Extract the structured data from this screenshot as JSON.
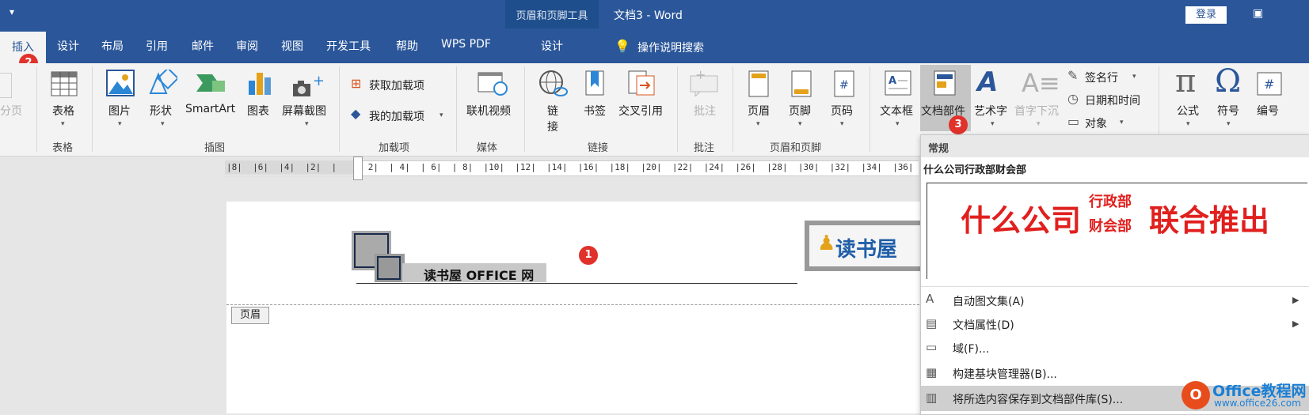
{
  "window": {
    "quick_access": "▾",
    "context_tab_group": "页眉和页脚工具",
    "doc_title": "文档3  -  Word",
    "login": "登录",
    "restore_icon": "▣"
  },
  "tabs": {
    "insert": "插入",
    "design": "设计",
    "layout": "布局",
    "references": "引用",
    "mailings": "邮件",
    "review": "审阅",
    "view": "视图",
    "developer": "开发工具",
    "help": "帮助",
    "wps_pdf": "WPS PDF",
    "context_design": "设计",
    "search_hint": "操作说明搜索"
  },
  "badges": {
    "one": "1",
    "two": "2",
    "three": "3"
  },
  "ribbon": {
    "page_break": "分页",
    "table": "表格",
    "picture": "图片",
    "shapes": "形状",
    "smartart": "SmartArt",
    "chart": "图表",
    "screenshot": "屏幕截图",
    "get_addins": "获取加载项",
    "my_addins": "我的加载项",
    "online_video": "联机视频",
    "link_line1": "链",
    "link_line2": "接",
    "bookmark": "书签",
    "cross_ref": "交叉引用",
    "comment": "批注",
    "header": "页眉",
    "footer": "页脚",
    "page_number": "页码",
    "text_box": "文本框",
    "quick_parts": "文档部件",
    "wordart": "艺术字",
    "drop_cap": "首字下沉",
    "signature_line": "签名行",
    "date_time": "日期和时间",
    "object": "对象",
    "equation": "公式",
    "symbol": "符号",
    "number": "编号",
    "groups": {
      "tables": "表格",
      "illustrations": "插图",
      "addins": "加载项",
      "media": "媒体",
      "links": "链接",
      "comments": "批注",
      "header_footer": "页眉和页脚"
    }
  },
  "ruler": "|8|  |6|  |4|  |2|  |    | 2|  | 4|  | 6|  | 8|  |10|  |12|  |14|  |16|  |18|  |20|  |22|  |24|  |26|  |28|  |30|  |32|  |34|  |36|",
  "document": {
    "header_text": "读书屋 OFFICE 网",
    "header_tag": "页眉",
    "logo_text": "读书屋"
  },
  "quick_parts_menu": {
    "section": "常规",
    "item_name": "什么公司行政部财会部",
    "preview": {
      "main_left": "什么公司",
      "small_top": "行政部",
      "small_bottom": "财会部",
      "main_right": "联合推出"
    },
    "items": [
      {
        "label": "自动图文集(A)",
        "icon": "A"
      },
      {
        "label": "文档属性(D)",
        "icon": "▤"
      },
      {
        "label": "域(F)...",
        "icon": "▭"
      },
      {
        "label": "构建基块管理器(B)...",
        "icon": "▦"
      },
      {
        "label": "将所选内容保存到文档部件库(S)...",
        "icon": "▥"
      }
    ]
  },
  "watermark": {
    "title": "Office教程网",
    "url": "www.office26.com"
  },
  "colors": {
    "brand": "#2b579a",
    "badge": "#e0312b",
    "preview_red": "#e0201e"
  }
}
